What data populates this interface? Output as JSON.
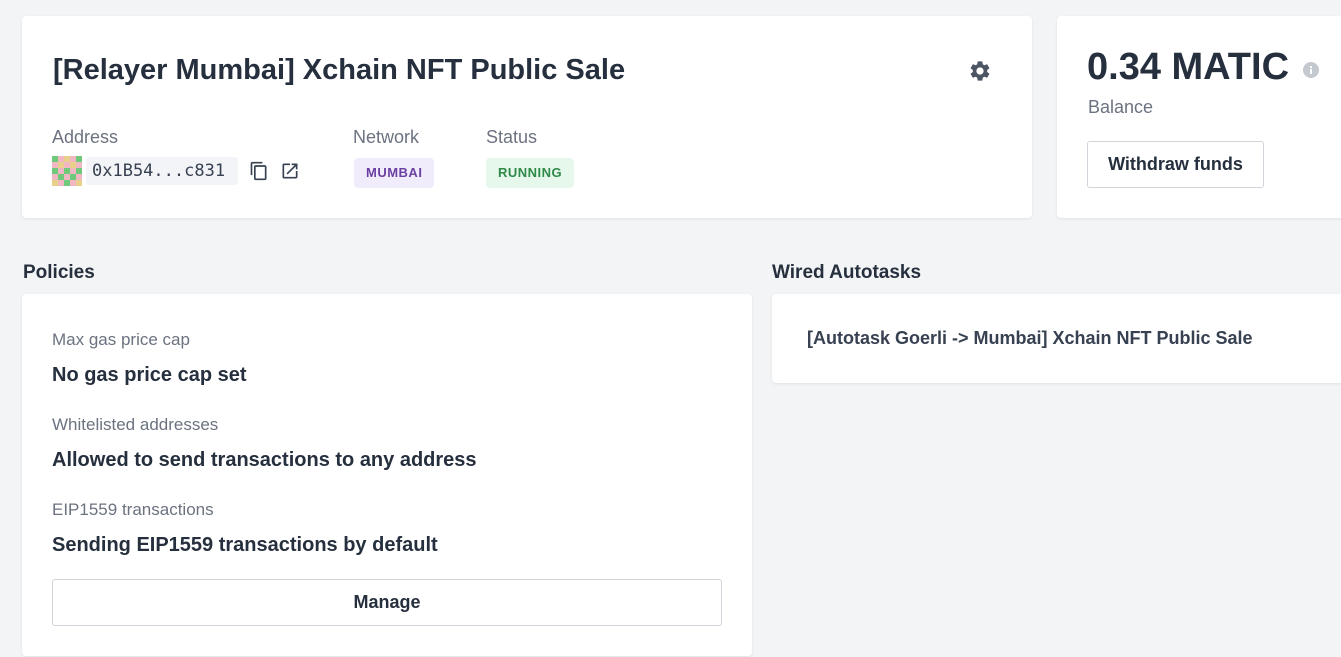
{
  "relayer": {
    "title": "[Relayer Mumbai] Xchain NFT Public Sale",
    "address_label": "Address",
    "address_short": "0x1B54...c831",
    "network_label": "Network",
    "network_value": "MUMBAI",
    "status_label": "Status",
    "status_value": "RUNNING"
  },
  "balance": {
    "amount": "0.34 MATIC",
    "label": "Balance",
    "withdraw_label": "Withdraw funds"
  },
  "policies": {
    "heading": "Policies",
    "items": [
      {
        "label": "Max gas price cap",
        "value": "No gas price cap set"
      },
      {
        "label": "Whitelisted addresses",
        "value": "Allowed to send transactions to any address"
      },
      {
        "label": "EIP1559 transactions",
        "value": "Sending EIP1559 transactions by default"
      }
    ],
    "manage_label": "Manage"
  },
  "autotasks": {
    "heading": "Wired Autotasks",
    "items": [
      "[Autotask Goerli -> Mumbai] Xchain NFT Public Sale"
    ]
  },
  "colors": {
    "page_bg": "#f3f4f6",
    "network_badge_bg": "#f1ecfb",
    "network_badge_text": "#6b3fa0",
    "status_badge_bg": "#e6f7ec",
    "status_badge_text": "#2f8a47"
  },
  "icons": [
    "gear-icon",
    "copy-icon",
    "external-link-icon",
    "info-icon",
    "identicon-avatar"
  ]
}
